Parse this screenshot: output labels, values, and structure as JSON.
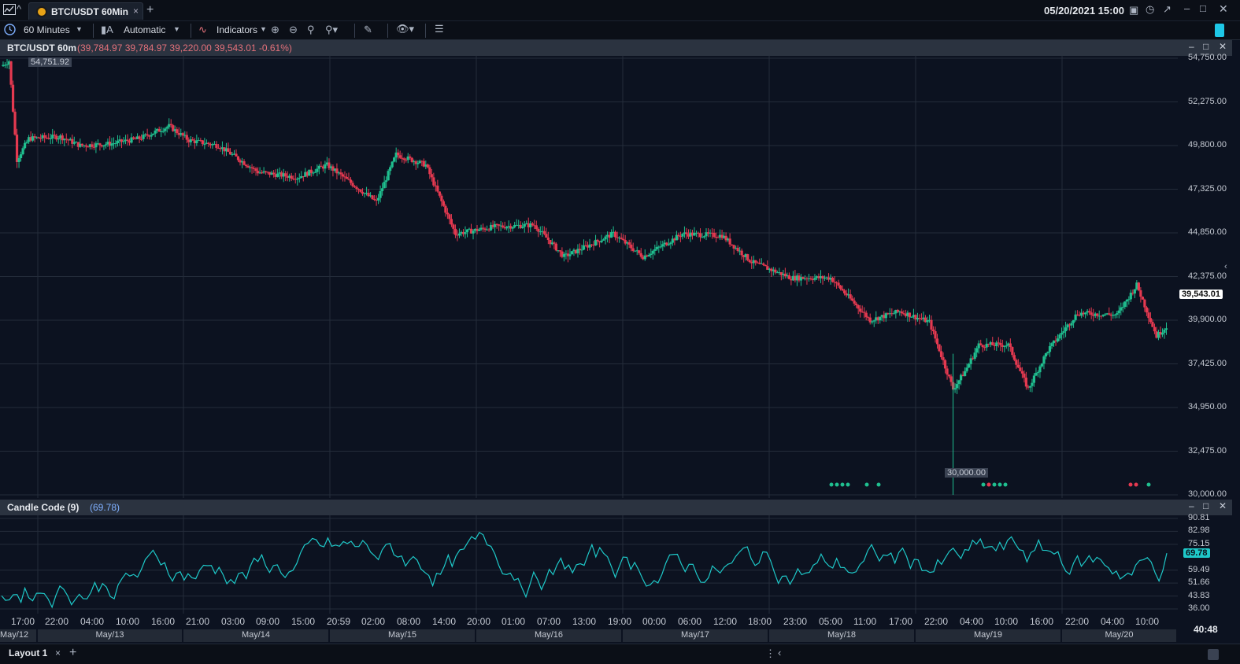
{
  "app": {
    "tab_title": "BTC/USDT 60Min",
    "tab_close": "×",
    "tab_add": "+",
    "datetime": "05/20/2021 15:00"
  },
  "toolbar": {
    "interval": "60 Minutes",
    "scale_mode": "Automatic",
    "indicators": "Indicators"
  },
  "price_panel": {
    "symbol": "BTC/USDT 60m",
    "ohlc": "(39,784.97  39,784.97  39,220.00  39,543.01  -0.61%)",
    "last_price": "39,543.01",
    "high_marker": "54,751.92",
    "low_marker": "30,000.00",
    "axis_labels": [
      "54,750.00",
      "52,275.00",
      "49,800.00",
      "47,325.00",
      "44,850.00",
      "42,375.00",
      "39,900.00",
      "37,425.00",
      "34,950.00",
      "32,475.00",
      "30,000.00"
    ],
    "colors": {
      "up": "#1fbf8f",
      "down": "#e53950",
      "grid": "#242c3a",
      "background": "#0c1220"
    }
  },
  "oscillator_panel": {
    "name": "Candle Code (9)",
    "value_display": "(69.78)",
    "last_value": "69.78",
    "axis_labels": [
      "90.81",
      "82.98",
      "75.15",
      "59.49",
      "51.66",
      "43.83",
      "36.00"
    ],
    "line_color": "#1ec8c8"
  },
  "time_axis": {
    "labels": [
      "17:00",
      "22:00",
      "04:00",
      "10:00",
      "16:00",
      "21:00",
      "03:00",
      "09:00",
      "15:00",
      "20:59",
      "02:00",
      "08:00",
      "14:00",
      "20:00",
      "01:00",
      "07:00",
      "13:00",
      "19:00",
      "00:00",
      "06:00",
      "12:00",
      "18:00",
      "23:00",
      "05:00",
      "11:00",
      "17:00",
      "22:00",
      "04:00",
      "10:00",
      "16:00",
      "22:00",
      "04:00",
      "10:00"
    ],
    "dates": [
      "May/12",
      "May/13",
      "May/14",
      "May/15",
      "May/16",
      "May/17",
      "May/18",
      "May/19",
      "May/20"
    ],
    "clock": "40:48"
  },
  "status_bar": {
    "layout_tab": "Layout 1",
    "layout_close": "×",
    "layout_add": "+"
  }
}
